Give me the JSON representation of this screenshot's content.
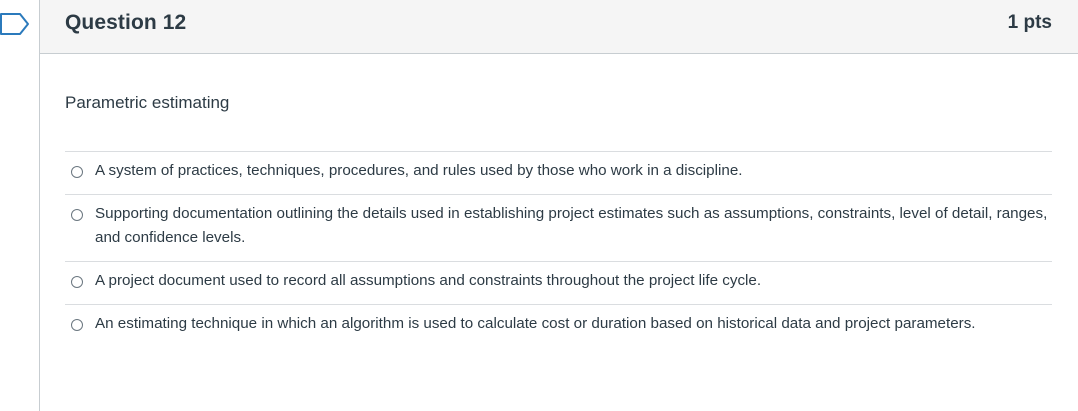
{
  "question": {
    "title": "Question 12",
    "points": "1 pts",
    "text": "Parametric estimating",
    "answers": [
      {
        "label": "A system of practices, techniques, procedures, and rules used by those who work in a discipline."
      },
      {
        "label": "Supporting documentation outlining the details used in establishing project estimates such as assumptions, constraints, level of detail, ranges, and confidence levels."
      },
      {
        "label": "A project document used to record all assumptions and constraints throughout the project life cycle."
      },
      {
        "label": "An estimating technique in which an algorithm is used to calculate cost or duration based on historical data and project parameters."
      }
    ]
  },
  "flag_icon": "flag-icon",
  "colors": {
    "flag": "#2b7abc",
    "header_bg": "#f5f5f5",
    "text": "#2d3b45",
    "border": "#c7cdd1"
  }
}
